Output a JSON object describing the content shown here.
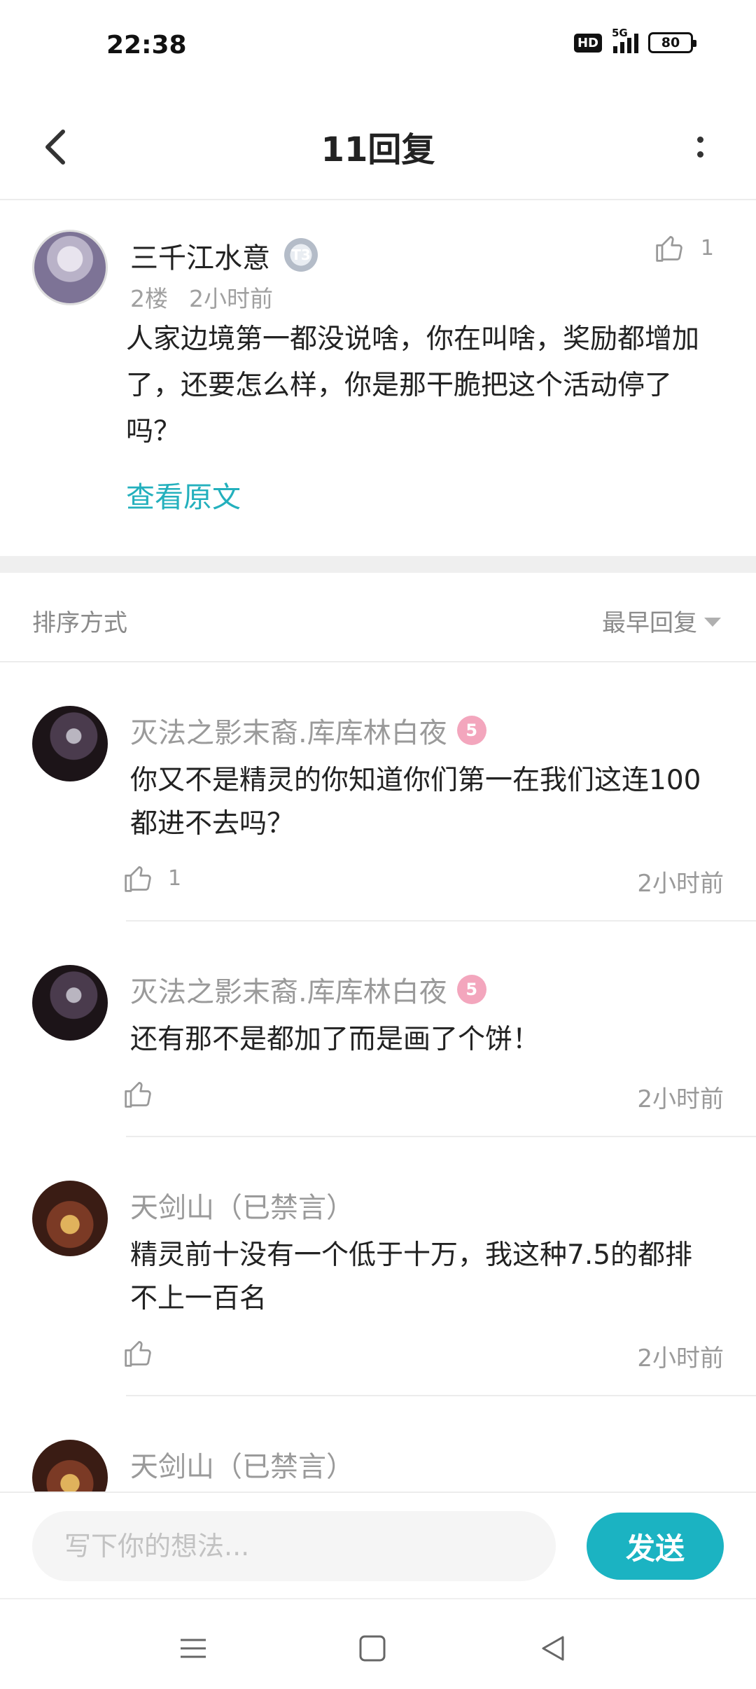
{
  "status_bar": {
    "time": "22:38",
    "hd_label": "HD",
    "network_label": "5G",
    "battery": "80"
  },
  "header": {
    "title": "11回复"
  },
  "post": {
    "author": "三千江水意",
    "level_badge": "T3",
    "floor": "2楼",
    "time": "2小时前",
    "likes": "1",
    "body": "人家边境第一都没说啥，你在叫啥，奖励都增加了，还要怎么样，你是那干脆把这个活动停了吗？",
    "view_original_label": "查看原文"
  },
  "sort": {
    "label": "排序方式",
    "selected": "最早回复"
  },
  "replies": [
    {
      "author": "灭法之影末裔.库库林白夜",
      "badge": "5",
      "body": "你又不是精灵的你知道你们第一在我们这连100都进不去吗？",
      "likes": "1",
      "time": "2小时前"
    },
    {
      "author": "灭法之影末裔.库库林白夜",
      "badge": "5",
      "body": "还有那不是都加了而是画了个饼！",
      "likes": "",
      "time": "2小时前"
    },
    {
      "author": "天剑山（已禁言）",
      "badge": "",
      "body": "精灵前十没有一个低于十万，我这种7.5的都排不上一百名",
      "likes": "",
      "time": "2小时前"
    },
    {
      "author": "天剑山（已禁言）",
      "badge": "",
      "body": "",
      "likes": "",
      "time": ""
    }
  ],
  "input_bar": {
    "placeholder": "写下你的想法...",
    "send_label": "发送"
  },
  "colors": {
    "accent": "#1bb3c2",
    "link": "#23b0bd",
    "muted": "#9a9a9a"
  }
}
